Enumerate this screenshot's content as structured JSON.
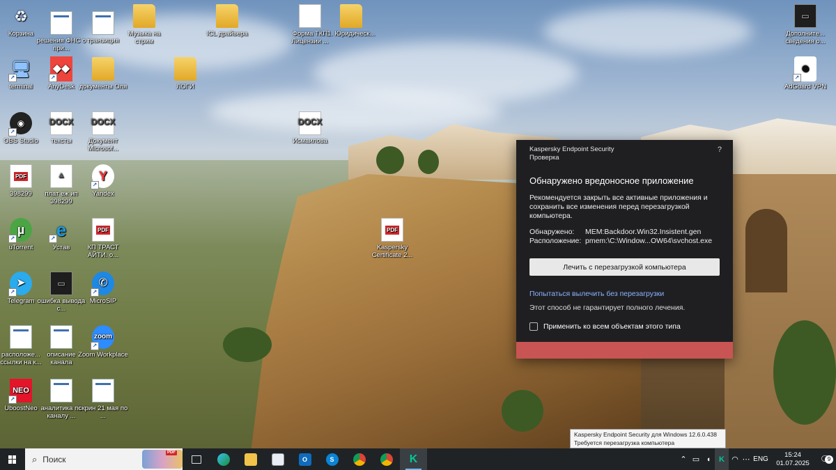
{
  "desktop_icons": [
    {
      "id": "recycle",
      "label": "Корзина",
      "kind": "recycle",
      "x": 0
    },
    {
      "id": "ifns",
      "label": "решения ФНС о при...",
      "kind": "win"
    },
    {
      "id": "tran",
      "label": "транзиция",
      "kind": "win"
    },
    {
      "id": "music",
      "label": "Музыка на стрим",
      "kind": "folder"
    },
    {
      "id": "icl",
      "label": "ICL драйвера",
      "kind": "folder"
    },
    {
      "id": "forma",
      "label": "Форма ТКП Лицензии ...",
      "kind": "doc"
    },
    {
      "id": "jur",
      "label": "1. Юридическ...",
      "kind": "folder"
    },
    {
      "id": "addl",
      "label": "Дополните... сведения о...",
      "kind": "dark"
    },
    {
      "id": "terminal",
      "label": "terminal",
      "kind": "pc"
    },
    {
      "id": "anydesk",
      "label": "AnyDesk",
      "kind": "anydesk"
    },
    {
      "id": "docsola",
      "label": "документы Оля",
      "kind": "folder"
    },
    {
      "id": "logi",
      "label": "ЛОГИ",
      "kind": "folder"
    },
    {
      "id": "adguard",
      "label": "AdGuard VPN",
      "kind": "adguard"
    },
    {
      "id": "obs",
      "label": "OBS Studio",
      "kind": "obs"
    },
    {
      "id": "texts",
      "label": "тексты",
      "kind": "docx"
    },
    {
      "id": "docms",
      "label": "Документ Microsof...",
      "kind": "docx"
    },
    {
      "id": "ismail",
      "label": "Исмаилова",
      "kind": "docx"
    },
    {
      "id": "p398",
      "label": "398299",
      "kind": "pdf"
    },
    {
      "id": "plat",
      "label": "плат еж ип 398299",
      "kind": "img"
    },
    {
      "id": "yandex",
      "label": "Yandex",
      "kind": "yandex"
    },
    {
      "id": "utorrent",
      "label": "uTorrent",
      "kind": "utorrent"
    },
    {
      "id": "ustav",
      "label": "Устав",
      "kind": "ie"
    },
    {
      "id": "kptrast",
      "label": "КП ТРАСТ АЙТИ. о...",
      "kind": "pdf"
    },
    {
      "id": "kavcert",
      "label": "Kaspersky Certificate 2...",
      "kind": "pdf"
    },
    {
      "id": "telegram",
      "label": "Telegram",
      "kind": "telegram"
    },
    {
      "id": "err",
      "label": "ошибка вывода с...",
      "kind": "dark"
    },
    {
      "id": "microsip",
      "label": "MicroSIP",
      "kind": "microsip"
    },
    {
      "id": "rasp",
      "label": "расположе... ссылки на к...",
      "kind": "win"
    },
    {
      "id": "opis",
      "label": "описание канала",
      "kind": "win"
    },
    {
      "id": "zoom",
      "label": "Zoom Workplace",
      "kind": "zoom"
    },
    {
      "id": "ubost",
      "label": "UboostNeo",
      "kind": "neo"
    },
    {
      "id": "anal",
      "label": "аналитика по каналу ...",
      "kind": "win"
    },
    {
      "id": "skrin",
      "label": "скрин 21 мая по ...",
      "kind": "win"
    }
  ],
  "dialog": {
    "product": "Kaspersky Endpoint Security",
    "section": "Проверка",
    "help": "?",
    "title": "Обнаружено вредоносное приложение",
    "message": "Рекомендуется закрыть все активные приложения и сохранить все изменения перед перезагрузкой компьютера.",
    "detected_label": "Обнаружено:",
    "detected_value": "MEM:Backdoor.Win32.Insistent.gen",
    "location_label": "Расположение:",
    "location_value": "pmem:\\C:\\Window...OW64\\svchost.exe",
    "primary_button": "Лечить с перезагрузкой компьютера",
    "link": "Попытаться вылечить без перезагрузки",
    "note": "Этот способ не гарантирует полного лечения.",
    "checkbox_label": "Применить ко всем объектам этого типа",
    "accent_color": "#c85454"
  },
  "tooltip": {
    "line1": "Kaspersky Endpoint Security для Windows 12.6.0.438",
    "line2": "Требуется перезагрузка компьютера"
  },
  "taskbar": {
    "search_placeholder": "Поиск",
    "pdf_badge": "PDF",
    "tray_lang": "ENG",
    "time": "15:24",
    "date": "01.07.2025",
    "notifications_count": "9"
  }
}
